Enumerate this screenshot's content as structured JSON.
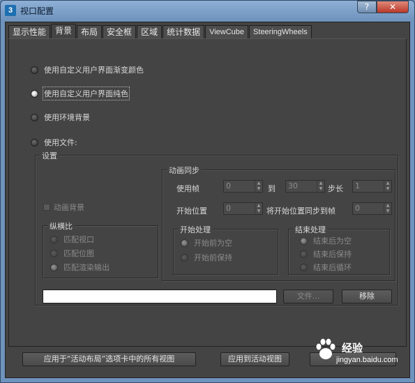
{
  "window": {
    "title": "视口配置",
    "app_icon": "3",
    "help_glyph": "?",
    "close_glyph": "✕"
  },
  "tabs": [
    {
      "label": "显示性能"
    },
    {
      "label": "背景",
      "active": true
    },
    {
      "label": "布局"
    },
    {
      "label": "安全框"
    },
    {
      "label": "区域"
    },
    {
      "label": "统计数据"
    },
    {
      "label": "ViewCube"
    },
    {
      "label": "SteeringWheels"
    }
  ],
  "background_options": [
    {
      "label": "使用自定义用户界面渐变颜色",
      "selected": false
    },
    {
      "label": "使用自定义用户界面纯色",
      "selected": true
    },
    {
      "label": "使用环境背景",
      "selected": false
    },
    {
      "label": "使用文件:",
      "selected": false
    }
  ],
  "settings": {
    "title": "设置",
    "animate_background_label": "动画背景",
    "aspect": {
      "title": "纵横比",
      "options": [
        {
          "label": "匹配视口",
          "selected": false
        },
        {
          "label": "匹配位图",
          "selected": false
        },
        {
          "label": "匹配渲染输出",
          "selected": true
        }
      ]
    },
    "anim_sync": {
      "title": "动画同步",
      "use_frame_label": "使用帧",
      "use_frame_value": "0",
      "to_label": "到",
      "to_value": "30",
      "step_label": "步长",
      "step_value": "1",
      "start_pos_label": "开始位置",
      "start_pos_value": "0",
      "sync_start_label": "将开始位置同步到帧",
      "sync_start_value": "0"
    },
    "start_processing": {
      "title": "开始处理",
      "options": [
        {
          "label": "开始前为空",
          "selected": true
        },
        {
          "label": "开始前保持",
          "selected": false
        }
      ]
    },
    "end_processing": {
      "title": "结束处理",
      "options": [
        {
          "label": "结束后为空",
          "selected": true
        },
        {
          "label": "结束后保持",
          "selected": false
        },
        {
          "label": "结束后循环",
          "selected": false
        }
      ]
    },
    "file_path_value": "",
    "file_button": "文件...",
    "remove_button": "移除"
  },
  "footer": {
    "apply_all_button": "应用于“活动布局”选项卡中的所有视图",
    "apply_active_button": "应用到活动视图",
    "third_button": ""
  },
  "watermark": {
    "brand": "经验",
    "url": "jingyan.baidu.com"
  }
}
